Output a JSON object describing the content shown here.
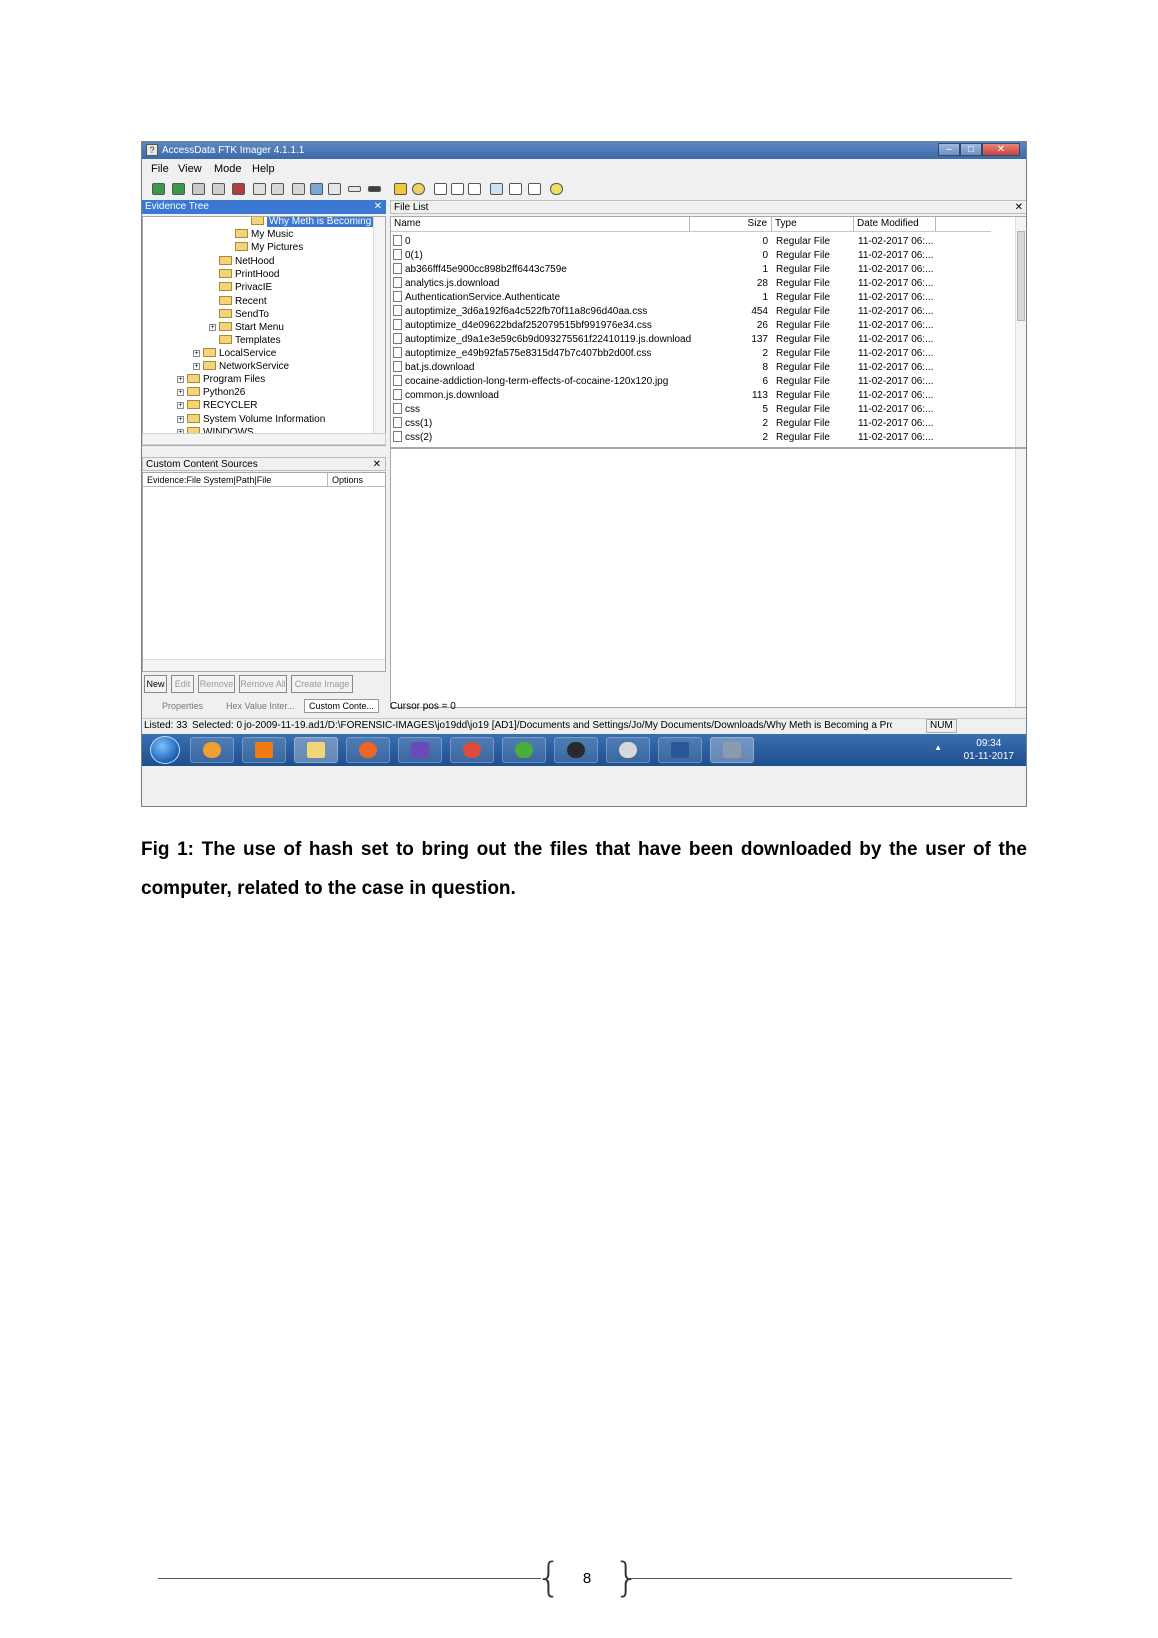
{
  "window": {
    "title": "AccessData FTK Imager 4.1.1.1",
    "controls": [
      "–",
      "□",
      "✕"
    ]
  },
  "menu": {
    "file": "File",
    "view": "View",
    "mode": "Mode",
    "help": "Help"
  },
  "evidence_tree": {
    "header": "Evidence Tree",
    "items": [
      "Why Meth is Becoming a P",
      "My Music",
      "My Pictures",
      "NetHood",
      "PrintHood",
      "PrivacIE",
      "Recent",
      "SendTo",
      "Start Menu",
      "Templates",
      "LocalService",
      "NetworkService",
      "Program Files",
      "Python26",
      "RECYCLER",
      "System Volume Information",
      "WINDOWS"
    ]
  },
  "file_list": {
    "header": "File List",
    "columns": {
      "name": "Name",
      "size": "Size",
      "type": "Type",
      "date": "Date Modified"
    },
    "rows": [
      {
        "name": "0",
        "size": "0",
        "type": "Regular File",
        "date": "11-02-2017 06:..."
      },
      {
        "name": "0(1)",
        "size": "0",
        "type": "Regular File",
        "date": "11-02-2017 06:..."
      },
      {
        "name": "ab366fff45e900cc898b2ff6443c759e",
        "size": "1",
        "type": "Regular File",
        "date": "11-02-2017 06:..."
      },
      {
        "name": "analytics.js.download",
        "size": "28",
        "type": "Regular File",
        "date": "11-02-2017 06:..."
      },
      {
        "name": "AuthenticationService.Authenticate",
        "size": "1",
        "type": "Regular File",
        "date": "11-02-2017 06:..."
      },
      {
        "name": "autoptimize_3d6a192f6a4c522fb70f11a8c96d40aa.css",
        "size": "454",
        "type": "Regular File",
        "date": "11-02-2017 06:..."
      },
      {
        "name": "autoptimize_d4e09622bdaf252079515bf991976e34.css",
        "size": "26",
        "type": "Regular File",
        "date": "11-02-2017 06:..."
      },
      {
        "name": "autoptimize_d9a1e3e59c6b9d093275561f22410119.js.download",
        "size": "137",
        "type": "Regular File",
        "date": "11-02-2017 06:..."
      },
      {
        "name": "autoptimize_e49b92fa575e8315d47b7c407bb2d00f.css",
        "size": "2",
        "type": "Regular File",
        "date": "11-02-2017 06:..."
      },
      {
        "name": "bat.js.download",
        "size": "8",
        "type": "Regular File",
        "date": "11-02-2017 06:..."
      },
      {
        "name": "cocaine-addiction-long-term-effects-of-cocaine-120x120.jpg",
        "size": "6",
        "type": "Regular File",
        "date": "11-02-2017 06:..."
      },
      {
        "name": "common.js.download",
        "size": "113",
        "type": "Regular File",
        "date": "11-02-2017 06:..."
      },
      {
        "name": "css",
        "size": "5",
        "type": "Regular File",
        "date": "11-02-2017 06:..."
      },
      {
        "name": "css(1)",
        "size": "2",
        "type": "Regular File",
        "date": "11-02-2017 06:..."
      },
      {
        "name": "css(2)",
        "size": "2",
        "type": "Regular File",
        "date": "11-02-2017 06:..."
      }
    ]
  },
  "custom_content": {
    "header": "Custom Content Sources",
    "col_path": "Evidence:File System|Path|File",
    "col_options": "Options",
    "buttons": {
      "new": "New",
      "edit": "Edit",
      "remove": "Remove",
      "remove_all": "Remove All",
      "create_image": "Create Image"
    }
  },
  "tabs": {
    "properties": "Properties",
    "hex": "Hex Value Inter...",
    "custom": "Custom Conte..."
  },
  "cursor_pos": "Cursor pos = 0",
  "status": {
    "listed": "Listed: 33",
    "selected": "Selected: 0",
    "path": "jo-2009-11-19.ad1/D:\\FORENSIC-IMAGES\\jo19dd\\jo19 [AD1]/Documents and Settings/Jo/My Documents/Downloads/Why Meth is Becoming a Probler",
    "num": "NUM"
  },
  "taskbar": {
    "time": "09:34",
    "date": "01-11-2017"
  },
  "caption": "Fig 1: The use of hash set to bring out the files that have been downloaded by the user of the computer, related to the case in question.",
  "page_number": "8"
}
